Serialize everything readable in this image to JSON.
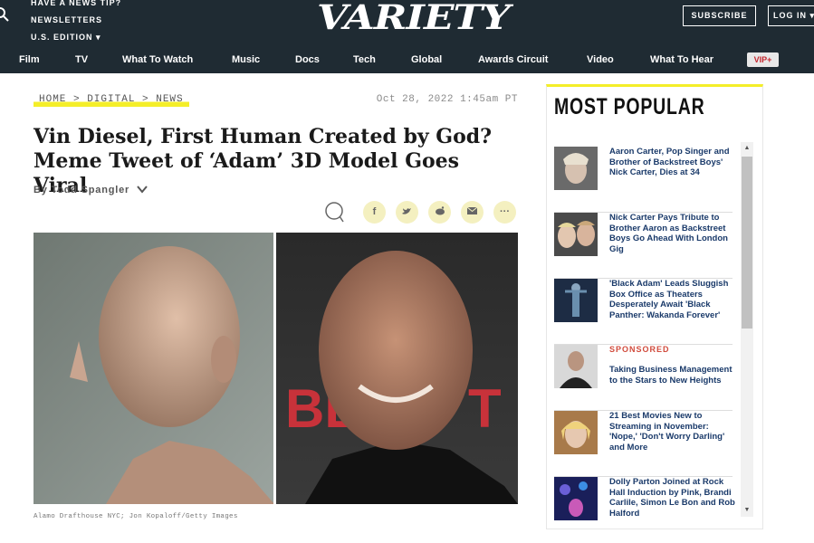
{
  "header": {
    "tip_link": "HAVE A NEWS TIP?",
    "newsletters_link": "NEWSLETTERS",
    "edition_link": "U.S. EDITION",
    "logo": "VARIETY",
    "subscribe_label": "SUBSCRIBE",
    "login_label": "LOG IN"
  },
  "nav": {
    "items": [
      "Film",
      "TV",
      "What To Watch",
      "Music",
      "Docs",
      "Tech",
      "Global",
      "Awards Circuit",
      "Video",
      "What To Hear"
    ],
    "vip_label": "VIP+"
  },
  "article": {
    "breadcrumb": "HOME > DIGITAL > NEWS",
    "date": "Oct 28, 2022 1:45am PT",
    "headline": "Vin Diesel, First Human Created by God? Meme Tweet of ‘Adam’ 3D Model Goes Viral",
    "byline": "By Todd Spangler",
    "share_icons": [
      "comment-icon",
      "facebook-icon",
      "twitter-icon",
      "reddit-icon",
      "email-icon",
      "more-icon"
    ],
    "photo_caption": "Alamo Drafthouse NYC; Jon Kopaloff/Getty Images"
  },
  "sidebar": {
    "title": "MOST POPULAR",
    "items": [
      {
        "title": "Aaron Carter, Pop Singer and Brother of Backstreet Boys' Nick Carter, Dies at 34",
        "label": ""
      },
      {
        "title": "Nick Carter Pays Tribute to Brother Aaron as Backstreet Boys Go Ahead With London Gig",
        "label": ""
      },
      {
        "title": "'Black Adam' Leads Sluggish Box Office as Theaters Desperately Await 'Black Panther: Wakanda Forever'",
        "label": ""
      },
      {
        "title": "Taking Business Management to the Stars to New Heights",
        "label": "SPONSORED"
      },
      {
        "title": "21 Best Movies New to Streaming in November: 'Nope,' 'Don't Worry Darling' and More",
        "label": ""
      },
      {
        "title": "Dolly Parton Joined at Rock Hall Induction by Pink, Brandi Carlile, Simon Le Bon and Rob Halford",
        "label": ""
      }
    ]
  },
  "colors": {
    "header_bg": "#1f2b33",
    "accent_yellow": "#f4ee29",
    "sponsored_red": "#d14b3c",
    "link_blue": "#1a3a6a"
  }
}
